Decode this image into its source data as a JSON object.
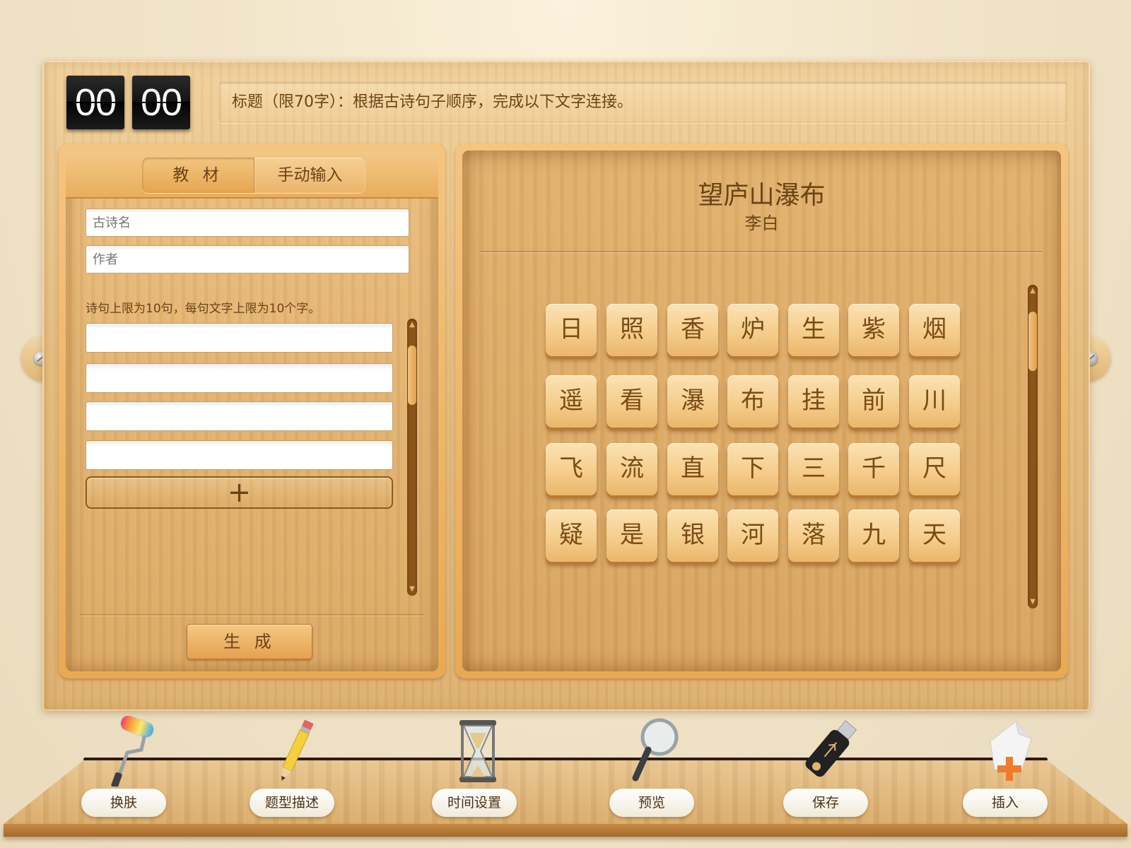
{
  "timer": {
    "minutes": "00",
    "seconds": "00"
  },
  "title_bar": {
    "text": "标题（限70字）：根据古诗句子顺序，完成以下文字连接。"
  },
  "left_panel": {
    "tabs": [
      "教 材",
      "手动输入"
    ],
    "active_tab": "手动输入",
    "poem_name_placeholder": "古诗名",
    "author_placeholder": "作者",
    "limit_note": "诗句上限为10句，每句文字上限为10个字。",
    "line_inputs": [
      "",
      "",
      "",
      ""
    ],
    "add_button": "+",
    "generate_button": "生 成"
  },
  "right_panel": {
    "poem_title": "望庐山瀑布",
    "poem_author": "李白",
    "character_rows": [
      [
        "日",
        "照",
        "香",
        "炉",
        "生",
        "紫",
        "烟"
      ],
      [
        "遥",
        "看",
        "瀑",
        "布",
        "挂",
        "前",
        "川"
      ],
      [
        "飞",
        "流",
        "直",
        "下",
        "三",
        "千",
        "尺"
      ],
      [
        "疑",
        "是",
        "银",
        "河",
        "落",
        "九",
        "天"
      ]
    ]
  },
  "toolbar": [
    {
      "label": "换肤",
      "icon": "paint-roller-icon"
    },
    {
      "label": "题型描述",
      "icon": "pencil-icon"
    },
    {
      "label": "时间设置",
      "icon": "hourglass-icon"
    },
    {
      "label": "预览",
      "icon": "magnifier-icon"
    },
    {
      "label": "保存",
      "icon": "usb-drive-icon"
    },
    {
      "label": "插入",
      "icon": "insert-page-icon"
    }
  ]
}
